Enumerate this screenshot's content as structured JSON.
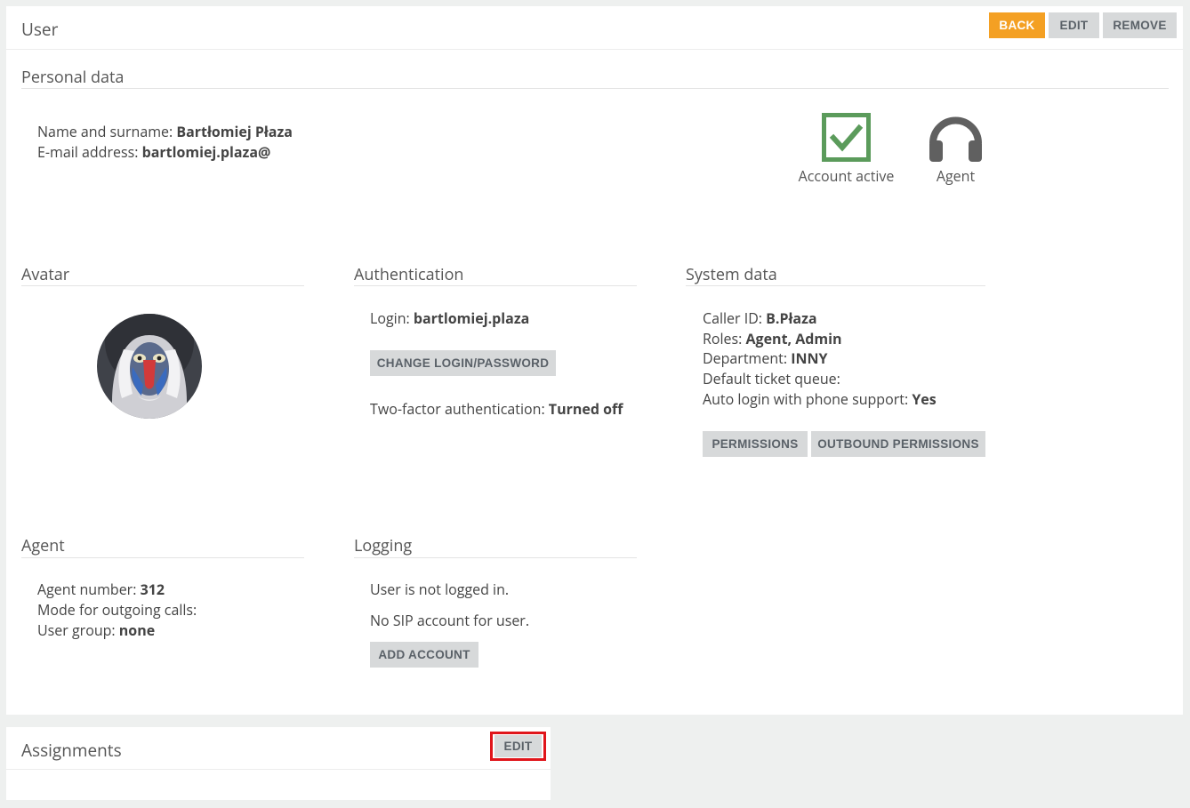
{
  "header": {
    "title": "User",
    "back_label": "BACK",
    "edit_label": "EDIT",
    "remove_label": "REMOVE"
  },
  "personal": {
    "section_title": "Personal data",
    "name_label": "Name and surname: ",
    "name_value": "Bartłomiej Płaza",
    "email_label": "E-mail address: ",
    "email_value": "bartlomiej.plaza@",
    "status_active_label": "Account active",
    "status_role_label": "Agent",
    "icons": {
      "active": "checkbox-checked-icon",
      "role": "headphones-icon"
    }
  },
  "avatar": {
    "section_title": "Avatar"
  },
  "authentication": {
    "section_title": "Authentication",
    "login_label": "Login: ",
    "login_value": "bartlomiej.plaza",
    "change_button": "CHANGE LOGIN/PASSWORD",
    "twofa_label": "Two-factor authentication: ",
    "twofa_value": "Turned off"
  },
  "system": {
    "section_title": "System data",
    "caller_label": "Caller ID: ",
    "caller_value": "B.Płaza",
    "roles_label": "Roles: ",
    "roles_value": "Agent, Admin",
    "department_label": "Department: ",
    "department_value": "INNY",
    "queue_label": "Default ticket queue:",
    "autologin_label": "Auto login with phone support: ",
    "autologin_value": "Yes",
    "permissions_button": "PERMISSIONS",
    "outbound_button": "OUTBOUND PERMISSIONS"
  },
  "agent": {
    "section_title": "Agent",
    "number_label": "Agent number: ",
    "number_value": "312",
    "mode_label": "Mode for outgoing calls:",
    "group_label": "User group: ",
    "group_value": "none"
  },
  "logging": {
    "section_title": "Logging",
    "status_text": "User is not logged in.",
    "sip_text": "No SIP account for user.",
    "add_button": "ADD ACCOUNT"
  },
  "assignments": {
    "title": "Assignments",
    "edit_label": "EDIT"
  },
  "colors": {
    "accent": "#f4a023",
    "active_green": "#5b9b5b",
    "highlight_red": "#e0151b"
  }
}
